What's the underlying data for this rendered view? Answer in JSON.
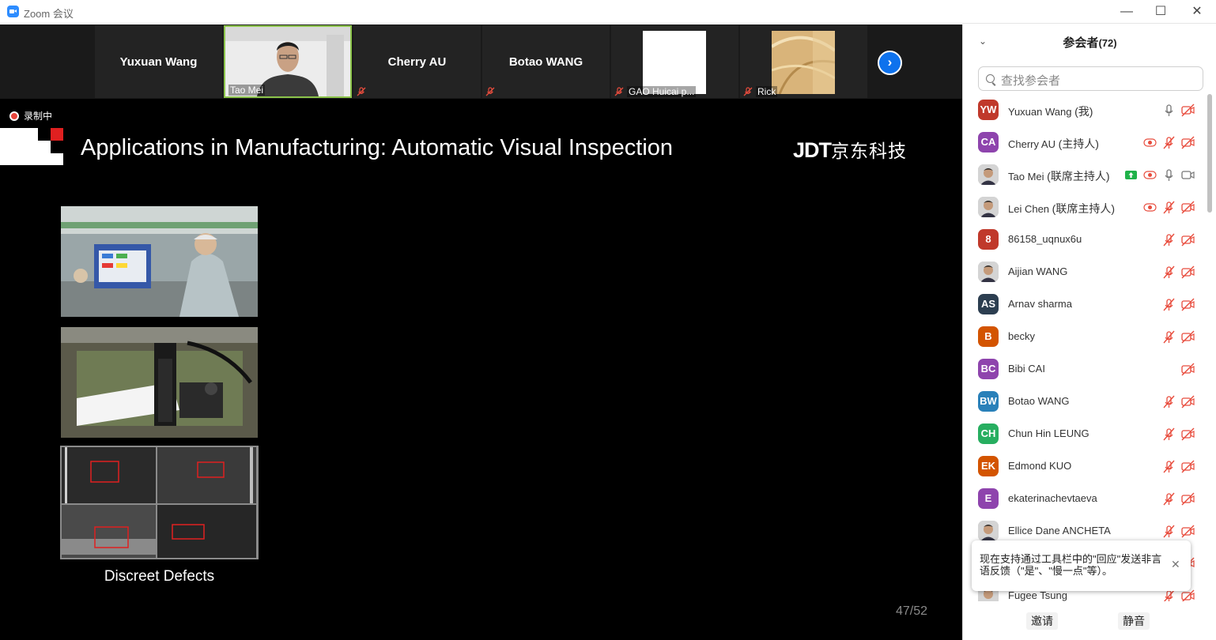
{
  "window": {
    "title": "Zoom 会议",
    "controls": [
      "minimize-icon",
      "maximize-icon",
      "close-icon"
    ]
  },
  "video_strip": {
    "tiles": [
      {
        "name": "Yuxuan Wang",
        "type": "name"
      },
      {
        "name": "Tao Mei",
        "type": "video",
        "highlight": "#8bc34a"
      },
      {
        "name": "Cherry AU",
        "type": "name",
        "muted": true
      },
      {
        "name": "Botao WANG",
        "type": "name",
        "muted": true
      },
      {
        "name": "GAO Huicai p...",
        "type": "image",
        "muted": true
      },
      {
        "name": "Rick",
        "type": "image",
        "muted": true
      }
    ],
    "next_icon": "chevron-right-icon"
  },
  "recording": {
    "label": "录制中",
    "color": "#e8453c"
  },
  "slide": {
    "title": "Applications in Manufacturing: Automatic Visual Inspection",
    "logo_text": "JDT",
    "logo_cn": "京东科技",
    "caption": "Discreet Defects",
    "page_number": "47/52"
  },
  "participants_panel": {
    "title": "参会者",
    "count": "(72)",
    "search_placeholder": "查找参会者",
    "participants": [
      {
        "initials": "YW",
        "name": "Yuxuan Wang",
        "role": "(我)",
        "color": "#c0392b",
        "icons": [
          "microphone-icon",
          "video-off-icon"
        ]
      },
      {
        "initials": "CA",
        "name": "Cherry AU",
        "role": "(主持人)",
        "color": "#8e44ad",
        "icons": [
          "recording-icon",
          "microphone-muted-icon",
          "video-off-icon"
        ]
      },
      {
        "initials": "",
        "name": "Tao Mei",
        "role": "(联席主持人)",
        "color": "#999999",
        "photo": true,
        "icons": [
          "share-screen-icon",
          "recording-icon",
          "microphone-icon",
          "video-icon"
        ]
      },
      {
        "initials": "",
        "name": "Lei Chen",
        "role": "(联席主持人)",
        "color": "#999999",
        "photo": true,
        "icons": [
          "recording-icon",
          "microphone-muted-icon",
          "video-off-icon"
        ]
      },
      {
        "initials": "8",
        "name": "86158_uqnux6u",
        "role": "",
        "color": "#c0392b",
        "icons": [
          "microphone-muted-icon",
          "video-off-icon"
        ]
      },
      {
        "initials": "",
        "name": "Aijian WANG",
        "role": "",
        "color": "#999999",
        "photo": true,
        "icons": [
          "microphone-muted-icon",
          "video-off-icon"
        ]
      },
      {
        "initials": "AS",
        "name": "Arnav sharma",
        "role": "",
        "color": "#2c3e50",
        "icons": [
          "microphone-muted-icon",
          "video-off-icon"
        ]
      },
      {
        "initials": "B",
        "name": "becky",
        "role": "",
        "color": "#d35400",
        "icons": [
          "microphone-muted-icon",
          "video-off-icon"
        ]
      },
      {
        "initials": "BC",
        "name": "Bibi CAI",
        "role": "",
        "color": "#8e44ad",
        "icons": [
          "video-off-icon"
        ]
      },
      {
        "initials": "BW",
        "name": "Botao WANG",
        "role": "",
        "color": "#2980b9",
        "icons": [
          "microphone-muted-icon",
          "video-off-icon"
        ]
      },
      {
        "initials": "CH",
        "name": "Chun Hin LEUNG",
        "role": "",
        "color": "#27ae60",
        "icons": [
          "microphone-muted-icon",
          "video-off-icon"
        ]
      },
      {
        "initials": "EK",
        "name": "Edmond KUO",
        "role": "",
        "color": "#d35400",
        "icons": [
          "microphone-muted-icon",
          "video-off-icon"
        ]
      },
      {
        "initials": "E",
        "name": "ekaterinachevtaeva",
        "role": "",
        "color": "#8e44ad",
        "icons": [
          "microphone-muted-icon",
          "video-off-icon"
        ]
      },
      {
        "initials": "",
        "name": "Ellice Dane ANCHETA",
        "role": "",
        "color": "#999999",
        "photo": true,
        "icons": [
          "microphone-muted-icon",
          "video-off-icon"
        ]
      },
      {
        "initials": "",
        "name": "",
        "role": "",
        "color": "#999999",
        "photo": true,
        "icons": [
          "microphone-muted-icon",
          "video-off-icon"
        ]
      },
      {
        "initials": "",
        "name": "Fugee Tsung",
        "role": "",
        "color": "#999999",
        "photo": true,
        "icons": [
          "microphone-muted-icon",
          "video-off-icon"
        ]
      }
    ],
    "toast": {
      "text": "现在支持通过工具栏中的\"回应\"发送非言语反馈（\"是\"、\"慢一点\"等）。"
    },
    "footer": {
      "invite": "邀请",
      "mute_all": "静音"
    }
  }
}
